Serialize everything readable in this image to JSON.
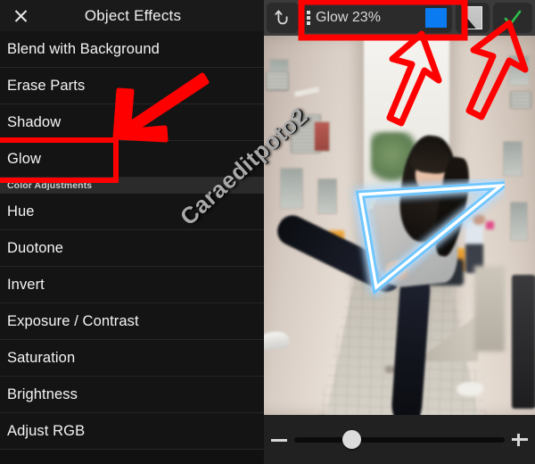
{
  "panel": {
    "title": "Object Effects",
    "close_icon": "close-icon",
    "sections": [
      {
        "header": null,
        "items": [
          {
            "label": "Blend with Background",
            "selected": false
          },
          {
            "label": "Erase Parts",
            "selected": false
          },
          {
            "label": "Shadow",
            "selected": false
          },
          {
            "label": "Glow",
            "selected": true
          }
        ]
      },
      {
        "header": "Color Adjustments",
        "items": [
          {
            "label": "Hue",
            "selected": false
          },
          {
            "label": "Duotone",
            "selected": false
          },
          {
            "label": "Invert",
            "selected": false
          },
          {
            "label": "Exposure / Contrast",
            "selected": false
          },
          {
            "label": "Saturation",
            "selected": false
          },
          {
            "label": "Brightness",
            "selected": false
          },
          {
            "label": "Adjust RGB",
            "selected": false
          }
        ]
      }
    ]
  },
  "toolbar": {
    "undo_icon": "undo-arrow-icon",
    "drag_handle_icon": "drag-dots-icon",
    "effect_label": "Glow 23%",
    "effect_name": "Glow",
    "effect_value": 23,
    "effect_value_text": "23%",
    "color_swatch_hex": "#0a7bf0",
    "gradient_icon": "gradient-thumbnail-icon",
    "confirm_icon": "green-check-icon",
    "confirm_color_hex": "#2ec14a"
  },
  "slider": {
    "minus_icon": "minus-icon",
    "plus_icon": "plus-icon",
    "value": 23,
    "min": 0,
    "max": 100,
    "thumb_position_percent": 25
  },
  "canvas": {
    "overlay_shape": "glowing-triangle",
    "overlay_glow_hex": "#8fd4ff",
    "background_hex": "#434343",
    "watermark": "Caraeditpoto2"
  },
  "annotations": {
    "accent_hex": "#ff0000",
    "marks": [
      {
        "type": "rectangle",
        "target": "Glow"
      },
      {
        "type": "rectangle",
        "target": "Glow 23%"
      },
      {
        "type": "arrow",
        "direction": "down-left",
        "target": "Glow"
      },
      {
        "type": "arrow",
        "direction": "up",
        "target": "Glow 23%"
      },
      {
        "type": "arrow",
        "direction": "up",
        "target": "green-check-icon"
      }
    ]
  }
}
